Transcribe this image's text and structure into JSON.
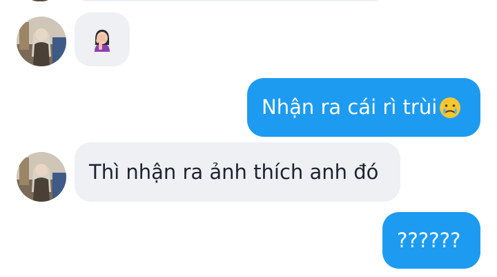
{
  "conversation": {
    "messages": [
      {
        "sender": "contact",
        "emoji": "woman-facepalming"
      },
      {
        "sender": "me",
        "text": "Nhận ra cái rì trùi",
        "emoji": "face-holding-back-tears"
      },
      {
        "sender": "contact",
        "text": "Thì nhận ra ảnh thích anh đó"
      },
      {
        "sender": "me",
        "text": "??????"
      }
    ]
  },
  "colors": {
    "outgoing_bubble": "#1d9bf0",
    "incoming_bubble": "#eef0f3",
    "incoming_text": "#1d2330"
  }
}
